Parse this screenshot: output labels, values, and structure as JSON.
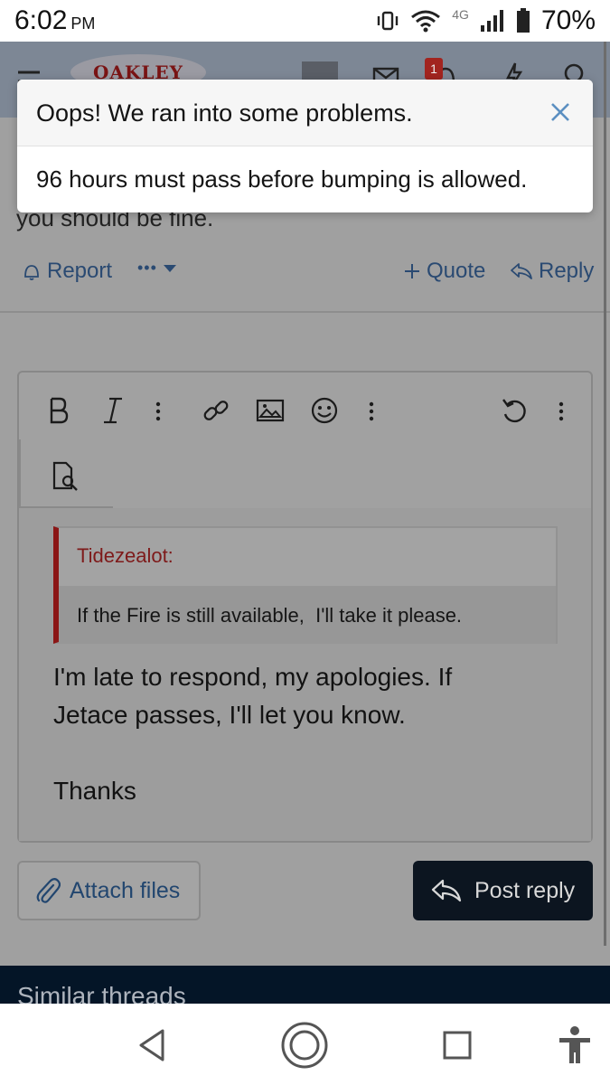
{
  "status_bar": {
    "time": "6:02",
    "ampm": "PM",
    "network": "4G",
    "battery": "70%"
  },
  "header": {
    "logo_text": "OAKLEY",
    "notification_count": "1"
  },
  "post": {
    "text_fragment": "you should be fine.",
    "report_label": "Report",
    "more_label": "•••",
    "quote_label": "Quote",
    "reply_label": "Reply"
  },
  "editor": {
    "quote_author": "Tidezealot:",
    "quote_text": "If the Fire is still available,  I'll take it please.",
    "reply_line1": "I'm late to respond, my apologies. If",
    "reply_line2": "Jetace passes, I'll let you know.",
    "reply_line3": "Thanks"
  },
  "buttons": {
    "attach_files": "Attach files",
    "post_reply": "Post reply"
  },
  "footer": {
    "similar_threads": "Similar threads"
  },
  "modal": {
    "title": "Oops! We ran into some problems.",
    "message": "96 hours must pass before bumping is allowed."
  },
  "colors": {
    "accent_link": "#2a5a92",
    "quote_border": "#8b1616",
    "primary_button": "#0c1520",
    "footer_bg": "#041527"
  }
}
